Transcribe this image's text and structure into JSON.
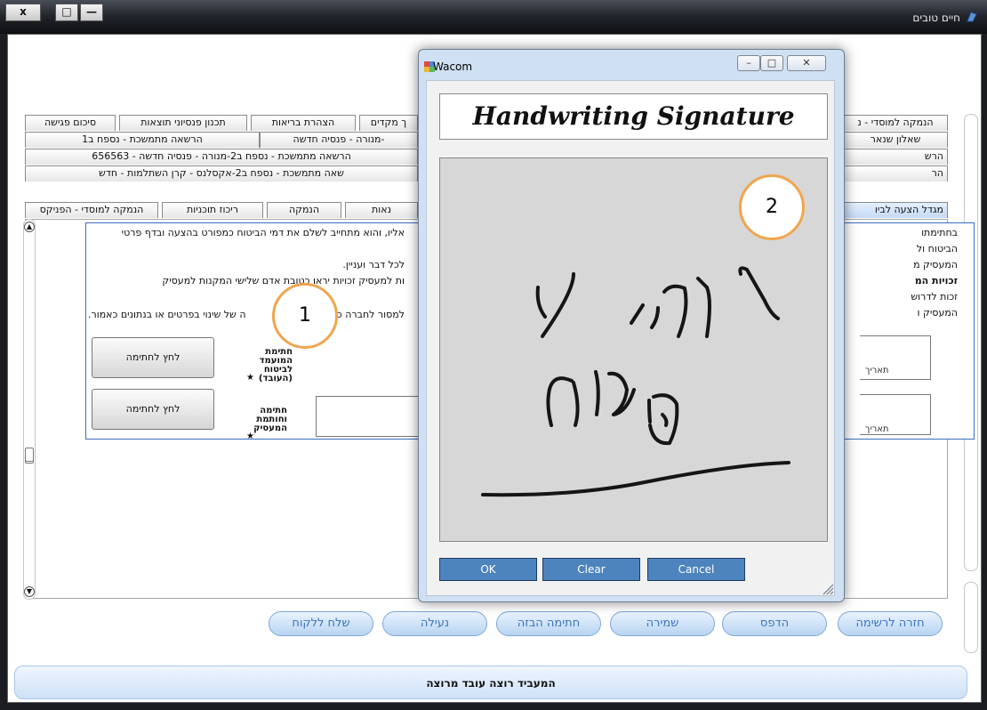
{
  "window": {
    "title": "חיים טובים",
    "controls": {
      "close": "x",
      "maximize": "□",
      "minimize": "—"
    }
  },
  "tabs": {
    "row1": [
      "הנמקה למוסדי - נ",
      "ך מקדים",
      "הצהרת בריאות",
      "תכנון פנסיוני תוצאות",
      "סיכום פגישה"
    ],
    "row2": [
      "שאלון שנאר",
      "-מנורה - פנסיה חדשה",
      "הרשאה מתמשכת - נספח ב1"
    ],
    "row3": [
      "הרש",
      "הרשאה מתמשכת - נספח ב2-מנורה - פנסיה חדשה - 656563"
    ],
    "row4": [
      "הר",
      "שאה מתמשכת - נספח ב2-אקסלנס - קרן השתלמות - חדש"
    ],
    "row5": [
      "מגדל הצעה לביו",
      "נאות",
      "הנמקה",
      "ריכוז תוכניות",
      "הנמקה למוסדי - הפניקס"
    ]
  },
  "form": {
    "lines": [
      "אליו, והוא מתחייב לשלם את דמי הביטוח כמפורט בהצעה ובדף פרטי",
      "לכל דבר ועניין.",
      "ות למעסיק זכויות יראו כטובת אדם שלישי המקנות למעסיק",
      "למסור לחברה כ",
      "ה של שינוי בפרטים או בנתונים כאמור."
    ],
    "right_lines": [
      "בחתימתו",
      "הביטוח ול",
      "המעסיק מ",
      "זכויות המ",
      "זכות לדרוש",
      "המעסיק ו"
    ],
    "sign_button_label": "לחץ לחתימה",
    "insured_sig_label": "חתימת המועמד לביטוח (העובד)",
    "employer_sig_label": "חתימה וחותמת המעסיק",
    "required_mark": "★",
    "date_label": "תאריך"
  },
  "bottom_buttons": [
    "חזרה לרשימה",
    "הדפס",
    "שמירה",
    "חתימה הבזה",
    "נעילה",
    "שלח ללקוח"
  ],
  "status_text": "המעביד רוצה עובד מרוצה",
  "dialog": {
    "title": "Wacom",
    "banner": "Handwriting Signature",
    "buttons": {
      "ok": "OK",
      "clear": "Clear",
      "cancel": "Cancel"
    }
  },
  "callouts": [
    "1",
    "2"
  ],
  "colors": {
    "accent": "#3c73ba",
    "callout": "#f0a54e",
    "dialog_button": "#4d84be"
  }
}
